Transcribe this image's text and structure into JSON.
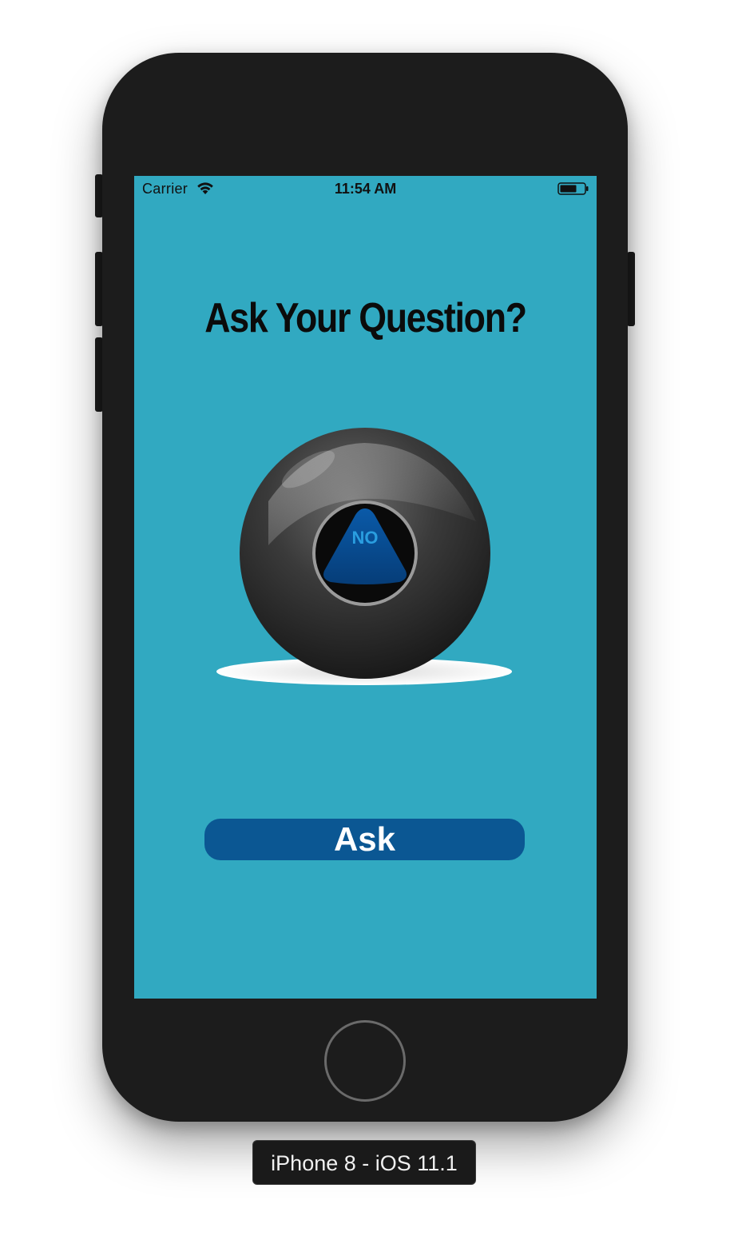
{
  "status_bar": {
    "carrier": "Carrier",
    "time": "11:54 AM"
  },
  "screen": {
    "background": "#31a9c1",
    "title": "Ask Your Question?",
    "ball": {
      "answer": "NO"
    },
    "ask_button": {
      "label": "Ask",
      "color": "#0b5793"
    }
  },
  "simulator": {
    "device_label": "iPhone 8 - iOS 11.1"
  },
  "icons": [
    "wifi-icon",
    "battery-icon",
    "magic-8-ball-icon",
    "home-button"
  ]
}
